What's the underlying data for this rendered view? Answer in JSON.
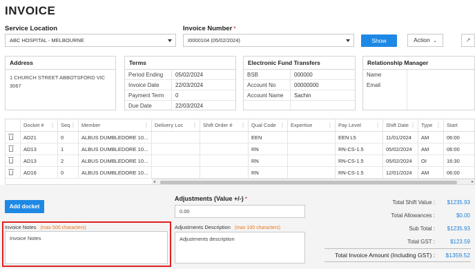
{
  "page": {
    "title": "INVOICE"
  },
  "service_location": {
    "label": "Service Location",
    "value": "ABC HOSPITAL - MELBOURNE"
  },
  "invoice_number": {
    "label": "Invoice Number",
    "required": "*",
    "value": "I0000104 (05/02/2024)"
  },
  "toolbar": {
    "show_label": "Show",
    "action_label": "Action"
  },
  "address": {
    "heading": "Address",
    "line1": "1 CHURCH STREET ABBOTSFORD VIC",
    "line2": "3067"
  },
  "terms": {
    "heading": "Terms",
    "rows": [
      {
        "k": "Period Ending",
        "v": "05/02/2024"
      },
      {
        "k": "Invoice Date",
        "v": "22/03/2024"
      },
      {
        "k": "Payment Term",
        "v": "0"
      },
      {
        "k": "Due Date",
        "v": "22/03/2024"
      }
    ]
  },
  "eft": {
    "heading": "Electronic Fund Transfers",
    "rows": [
      {
        "k": "BSB",
        "v": "000000"
      },
      {
        "k": "Account No",
        "v": "00000000"
      },
      {
        "k": "Account Name",
        "v": "Sachin"
      },
      {
        "k": "",
        "v": ""
      }
    ]
  },
  "relationship": {
    "heading": "Relationship Manager",
    "rows": [
      {
        "k": "Name",
        "v": ""
      },
      {
        "k": "Email",
        "v": ""
      },
      {
        "k": "",
        "v": ""
      },
      {
        "k": "",
        "v": ""
      }
    ]
  },
  "grid": {
    "columns": [
      "Docket #",
      "Seq",
      "Member",
      "Delivery Loc",
      "Shift Order #",
      "Qual Code",
      "Expertise",
      "Pay Level",
      "Shift Date",
      "Type",
      "Start"
    ],
    "rows": [
      [
        "AD21",
        "0",
        "ALBUS DUMBLEDORE 10...",
        "",
        "",
        "EEN",
        "",
        "EEN L5",
        "11/01/2024",
        "AM",
        "06:00"
      ],
      [
        "AD13",
        "1",
        "ALBUS DUMBLEDORE 10...",
        "",
        "",
        "RN",
        "",
        "RN-CS-1.5",
        "05/02/2024",
        "AM",
        "06:00"
      ],
      [
        "AD13",
        "2",
        "ALBUS DUMBLEDORE 10...",
        "",
        "",
        "RN",
        "",
        "RN-CS-1.5",
        "05/02/2024",
        "OI",
        "16:30"
      ],
      [
        "AD16",
        "0",
        "ALBUS DUMBLEDORE 10...",
        "",
        "",
        "RN",
        "",
        "RN-CS-1.5",
        "12/01/2024",
        "AM",
        "06:00"
      ]
    ]
  },
  "add_docket": {
    "label": "Add docket"
  },
  "adjustments": {
    "label": "Adjustments (Value +/-)",
    "required": "*",
    "value": "0.00"
  },
  "invoice_notes": {
    "label": "Invoice Notes",
    "hint": "(max 500 characters)",
    "placeholder": "Invoice Notes"
  },
  "adjustments_desc": {
    "label": "Adjustments Description",
    "hint": "(max 100 characters)",
    "placeholder": "Adjustments description"
  },
  "totals": {
    "total_shift_value_label": "Total Shift Value :",
    "total_shift_value": "$1235.93",
    "total_allowances_label": "Total Allowances :",
    "total_allowances": "$0.00",
    "sub_total_label": "Sub Total :",
    "sub_total": "$1235.93",
    "total_gst_label": "Total GST :",
    "total_gst": "$123.59",
    "grand_total_label": "Total Invoice Amount (Including GST) :",
    "grand_total": "$1359.52"
  },
  "colors": {
    "primary": "#1e88e5",
    "highlight": "#e02020",
    "hint": "#e8761c",
    "total_value": "#1e7fd4"
  }
}
